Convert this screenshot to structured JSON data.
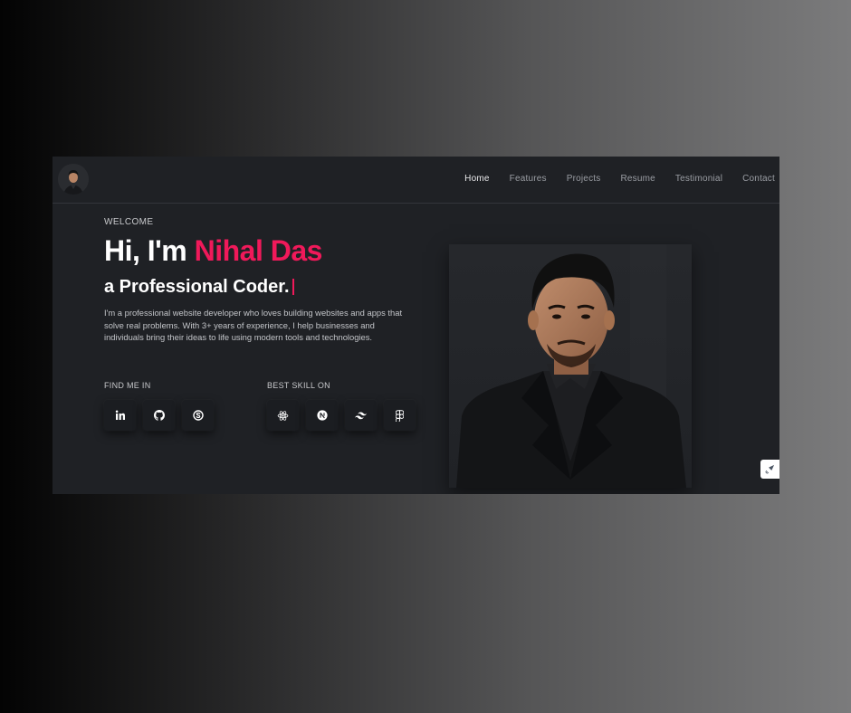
{
  "nav": {
    "items": [
      {
        "label": "Home",
        "active": true
      },
      {
        "label": "Features",
        "active": false
      },
      {
        "label": "Projects",
        "active": false
      },
      {
        "label": "Resume",
        "active": false
      },
      {
        "label": "Testimonial",
        "active": false
      },
      {
        "label": "Contact",
        "active": false
      }
    ]
  },
  "hero": {
    "welcome": "WELCOME",
    "greeting": "Hi, I'm ",
    "name": "Nihal Das",
    "subtitle": "a Professional Coder.",
    "description": "I'm a professional website developer who loves building websites and apps that solve real problems. With 3+ years of experience, I help businesses and individuals bring their ideas to life using modern tools and technologies."
  },
  "find_me": {
    "label": "FIND ME IN",
    "icons": [
      "linkedin-icon",
      "github-icon",
      "skype-icon"
    ]
  },
  "best_skill": {
    "label": "BEST SKILL ON",
    "icons": [
      "react-icon",
      "nextjs-icon",
      "tailwind-icon",
      "figma-icon"
    ]
  },
  "colors": {
    "accent": "#f0195a",
    "background": "#1f2125"
  }
}
